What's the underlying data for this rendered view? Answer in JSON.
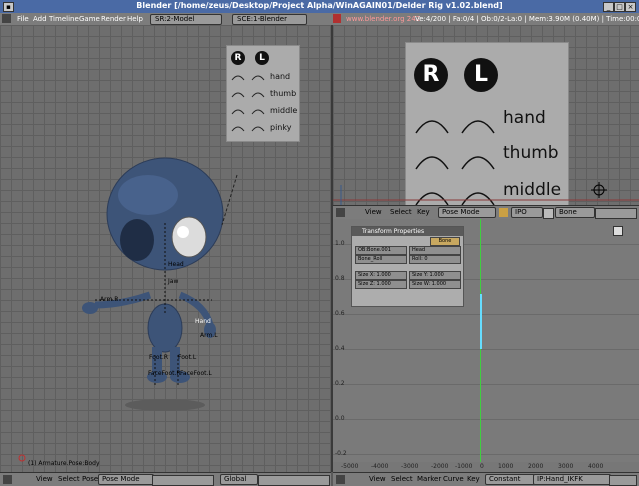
{
  "window": {
    "title": "Blender [/home/zeus/Desktop/Project Alpha/WinAGAIN01/Delder Rig v1.02.blend]"
  },
  "menubar": {
    "items": [
      "File",
      "Add",
      "Timeline",
      "Game",
      "Render",
      "Help"
    ],
    "screen_field": "SR:2-Model",
    "scene_field": "SCE:1-Blender",
    "renderer_field": "www.blender.org 242",
    "stats": "Ve:4/200 | Fa:0/4 | Ob:0/2-La:0 | Mem:3.90M (0.40M) | Time:00:00.00 (Image) Frame:1 | Ve:2,200 disabled"
  },
  "left_viewport": {
    "object_label": "(1) Armature.Pose:Body",
    "bone_labels": [
      "Hand",
      "Arm.L",
      "Arm.R",
      "Foot.L",
      "Foot.R",
      "FaceFoot.L",
      "FaceFoot.R",
      "Head",
      "Jaw"
    ],
    "widget": {
      "r_label": "R",
      "l_label": "L",
      "rows": [
        "hand",
        "thumb",
        "middle",
        "pinky"
      ]
    }
  },
  "right_viewport": {
    "widget": {
      "r_label": "R",
      "l_label": "L",
      "rows": [
        "hand",
        "thumb",
        "middle"
      ]
    }
  },
  "ipo_header": {
    "items": [
      "View",
      "Select",
      "Key"
    ],
    "mode_field": "Pose Mode",
    "channel_field": "IPO",
    "key_field": "Bone"
  },
  "transform_panel": {
    "title": "Transform Properties",
    "tab": "Bone",
    "fields": [
      {
        "label": "OB:Bone.001",
        "value": "Head"
      },
      {
        "label": "Bone_Roll",
        "value": "Roll: 0"
      },
      {
        "label": "Size X: 1.000",
        "value": "Size Y: 1.000"
      },
      {
        "label": "Size Z: 1.000",
        "value": "Size W: 1.000"
      }
    ]
  },
  "ipo_graph": {
    "y_labels": [
      "1.0",
      "0.8",
      "0.6",
      "0.4",
      "0.2",
      "0.0",
      "-0.2",
      "-0.4"
    ],
    "x_labels": [
      "-5000",
      "-4000",
      "-3000",
      "-2000",
      "-1000",
      "0",
      "1000",
      "2000",
      "3000",
      "4000"
    ]
  },
  "bottom_left": {
    "items": [
      "View",
      "Select",
      "Pose"
    ],
    "mode_field": "Pose Mode",
    "pivot_field": "Global"
  },
  "bottom_right": {
    "items": [
      "View",
      "Select",
      "Marker",
      "Curve",
      "Key"
    ],
    "field1": "Constant",
    "field2": "IP:Hand_IKFK"
  },
  "colors": {
    "titlebar": "#4a6aa5",
    "header_gray": "#7c7c7c",
    "viewport_gray": "#6e6e6e",
    "character_blue": "#3d5478",
    "green_line": "#3fcf3f",
    "cyan_curve": "#66ddff"
  }
}
